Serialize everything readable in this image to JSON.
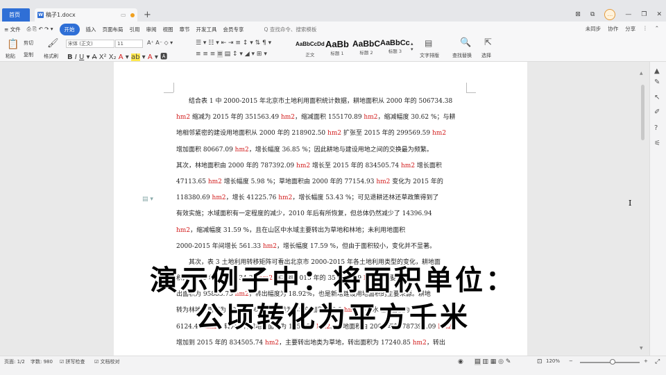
{
  "titlebar": {
    "home_tab": "首页",
    "doc_tab": "稿子1.docx",
    "new_tab": "+",
    "avatar": "…",
    "controls": [
      "⊠",
      "⧉",
      "—",
      "❐",
      "✕"
    ]
  },
  "menubar": {
    "file": "≡ 文件",
    "items": [
      "开始",
      "插入",
      "页面布局",
      "引用",
      "审阅",
      "视图",
      "章节",
      "开发工具",
      "会员专享"
    ],
    "active": "开始",
    "search": "Q 查找命令、搜索模板",
    "right": [
      "未同步",
      "协作",
      "分享"
    ]
  },
  "ribbon": {
    "paste": "粘贴",
    "cut": "剪切",
    "copy": "复制",
    "format_painter": "格式刷",
    "font_name": "宋体 (正文)",
    "font_size": "11",
    "styles": [
      {
        "sample": "AaBbCcDd",
        "label": "正文"
      },
      {
        "sample": "AaBb",
        "label": "标题 1"
      },
      {
        "sample": "AaBbC",
        "label": "标题 2"
      },
      {
        "sample": "AaBbCc",
        "label": "标题 3"
      }
    ],
    "text_layout": "文字排版",
    "find_replace": "查找替换",
    "select": "选择"
  },
  "document": {
    "lines": [
      {
        "segs": [
          [
            "结合表 1 中 2000-2015 年北京市土地利用面积统计数据，耕地面积从 2000 年的 506734.38",
            "n"
          ]
        ],
        "indent": true
      },
      {
        "segs": [
          [
            "hm2",
            "r"
          ],
          [
            " 缩减为 2015 年的 351563.49 ",
            "n"
          ],
          [
            "hm2",
            "r"
          ],
          [
            "，缩减面积 155170.89 ",
            "n"
          ],
          [
            "hm2",
            "r"
          ],
          [
            "，缩减幅度 30.62 %；与耕",
            "n"
          ]
        ]
      },
      {
        "segs": [
          [
            "地相邻紧密的建设用地面积从 2000 年的 218902.50 ",
            "n"
          ],
          [
            "hm2",
            "r"
          ],
          [
            " 扩张至 2015 年的 299569.59 ",
            "n"
          ],
          [
            "hm2",
            "r"
          ]
        ]
      },
      {
        "segs": [
          [
            "增加面积 80667.09 ",
            "n"
          ],
          [
            "hm2",
            "r"
          ],
          [
            "，增长幅度 36.85 %；因此耕地与建设用地之间的交换最为频繁。",
            "n"
          ]
        ]
      },
      {
        "segs": [
          [
            "其次，林地面积由 2000 年的 787392.09 ",
            "n"
          ],
          [
            "hm2",
            "r"
          ],
          [
            " 增长至 2015 年的 834505.74 ",
            "n"
          ],
          [
            "hm2",
            "r"
          ],
          [
            " 增长面积",
            "n"
          ]
        ]
      },
      {
        "segs": [
          [
            "47113.65 ",
            "n"
          ],
          [
            "hm2",
            "r"
          ],
          [
            " 增长幅度 5.98 %；草地面积由 2000 年的 77154.93 ",
            "n"
          ],
          [
            "hm2",
            "r"
          ],
          [
            " 变化为 2015 年的",
            "n"
          ]
        ]
      },
      {
        "segs": [
          [
            "118380.69 ",
            "n"
          ],
          [
            "hm2",
            "r"
          ],
          [
            "，增长 41225.76 ",
            "n"
          ],
          [
            "hm2",
            "r"
          ],
          [
            "，增长幅度 53.43 %；可见退耕还林还草政策得到了",
            "n"
          ]
        ]
      },
      {
        "segs": [
          [
            "有效实施；水域面积有一定程度的减少，2010 年后有所恢复，但总体仍然减少了 14396.94",
            "n"
          ]
        ]
      },
      {
        "segs": [
          [
            "hm2",
            "r"
          ],
          [
            "，缩减幅度 31.59 %，且在山区中水域主要转出为草地和林地；未利用地面积",
            "n"
          ]
        ]
      },
      {
        "segs": [
          [
            "2000-2015 年间增长 561.33 ",
            "n"
          ],
          [
            "hm2",
            "r"
          ],
          [
            "，增长幅度 17.59 %，但由于面积较小，变化并不显著。",
            "n"
          ]
        ]
      },
      {
        "segs": [
          [
            "其次，表 3 土地利用转移矩阵可看出北京市 2000-2015 年各土地利用类型的变化，耕地面",
            "n"
          ]
        ],
        "indent": true
      },
      {
        "segs": [
          [
            "积由 2000 年的 506734.38 ",
            "n"
          ],
          [
            "hm2",
            "r"
          ],
          [
            " 缩减到 2015 年的 351563.49 ",
            "n"
          ],
          [
            "hm2",
            "r"
          ],
          [
            "，主要转",
            "n"
          ]
        ]
      },
      {
        "segs": [
          [
            "出面积为 95883.75 ",
            "n"
          ],
          [
            "hm2",
            "r"
          ],
          [
            "，转出幅度为 18.92%，也是新增建设用地面积的主要来源。耕地",
            "n"
          ]
        ]
      },
      {
        "segs": [
          [
            "转为林地的面积为 40270.56 ",
            "n"
          ],
          [
            "hm2",
            "r"
          ],
          [
            "，转为草地的面积为 3.0 ",
            "n"
          ],
          [
            "hm2",
            "r"
          ],
          [
            " 转为水域的面积为",
            "n"
          ]
        ]
      },
      {
        "segs": [
          [
            "6124.41 ",
            "n"
          ],
          [
            "hm2",
            "r"
          ],
          [
            "，转为未利用地的面积为 1452.33 ",
            "n"
          ],
          [
            "hm2",
            "r"
          ],
          [
            "。林地面积由 2000 年的 787392.09 ",
            "n"
          ],
          [
            "hm2",
            "r"
          ]
        ]
      },
      {
        "segs": [
          [
            "增加到 2015 年的 834505.74 ",
            "n"
          ],
          [
            "hm2",
            "r"
          ],
          [
            "，主要转出地类为草地，转出面积为 17240.85 ",
            "n"
          ],
          [
            "hm2",
            "r"
          ],
          [
            "，转出",
            "n"
          ]
        ]
      }
    ]
  },
  "overlay_caption": {
    "line1": "演示例子中：将面积单位：",
    "line2": "公顷转化为平方千米"
  },
  "statusbar": {
    "page": "页面: 1/2",
    "words": "字数: 980",
    "spellcheck": "拼写检查",
    "doc_check": "文档校对",
    "zoom": "120%",
    "zoom_level": 0.55
  },
  "colors": {
    "accent": "#2f6fd6",
    "unit_red": "#d21b1b"
  }
}
